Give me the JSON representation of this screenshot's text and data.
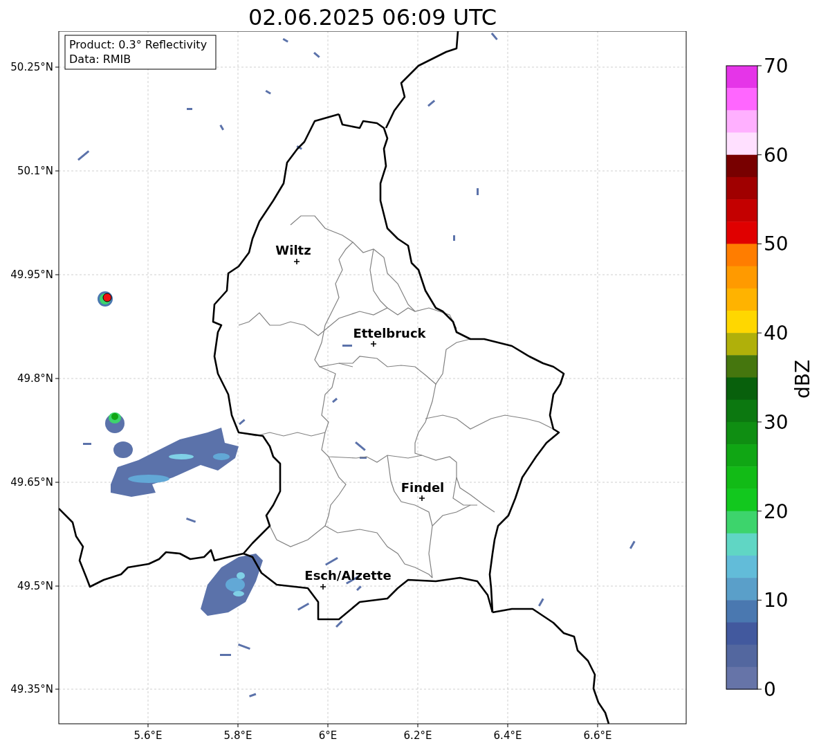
{
  "title": "02.06.2025 06:09 UTC",
  "map": {
    "info_box": [
      "Product: 0.3° Reflectivity",
      "Data: RMIB"
    ],
    "lat_labels": [
      "50.25°N",
      "50.1°N",
      "49.95°N",
      "49.8°N",
      "49.65°N",
      "49.5°N",
      "49.35°N"
    ],
    "lon_labels": [
      "5.6°E",
      "5.8°E",
      "6°E",
      "6.2°E",
      "6.4°E",
      "6.6°E"
    ],
    "cities": [
      {
        "name": "Wiltz"
      },
      {
        "name": "Ettelbruck"
      },
      {
        "name": "Findel"
      },
      {
        "name": "Esch/Alzette"
      }
    ]
  },
  "colorbar": {
    "label": "dBZ",
    "ticks": [
      "70",
      "60",
      "50",
      "40",
      "30",
      "20",
      "10",
      "0"
    ],
    "bins": [
      {
        "color": "#e535e8"
      },
      {
        "color": "#ff66ff"
      },
      {
        "color": "#ffb0ff"
      },
      {
        "color": "#ffe0ff"
      },
      {
        "color": "#780000"
      },
      {
        "color": "#a00000"
      },
      {
        "color": "#c40000"
      },
      {
        "color": "#e00000"
      },
      {
        "color": "#ff7d00"
      },
      {
        "color": "#ff9a00"
      },
      {
        "color": "#ffb300"
      },
      {
        "color": "#ffd700"
      },
      {
        "color": "#b0b00a"
      },
      {
        "color": "#45760e"
      },
      {
        "color": "#08600c"
      },
      {
        "color": "#0c7810"
      },
      {
        "color": "#0f8e12"
      },
      {
        "color": "#10a614"
      },
      {
        "color": "#12bb16"
      },
      {
        "color": "#12c81e"
      },
      {
        "color": "#3dd46c"
      },
      {
        "color": "#60d6c4"
      },
      {
        "color": "#62bcd9"
      },
      {
        "color": "#5a9fc9"
      },
      {
        "color": "#4a78b0"
      },
      {
        "color": "#42599e"
      },
      {
        "color": "#53679f"
      },
      {
        "color": "#6674a8"
      }
    ]
  }
}
